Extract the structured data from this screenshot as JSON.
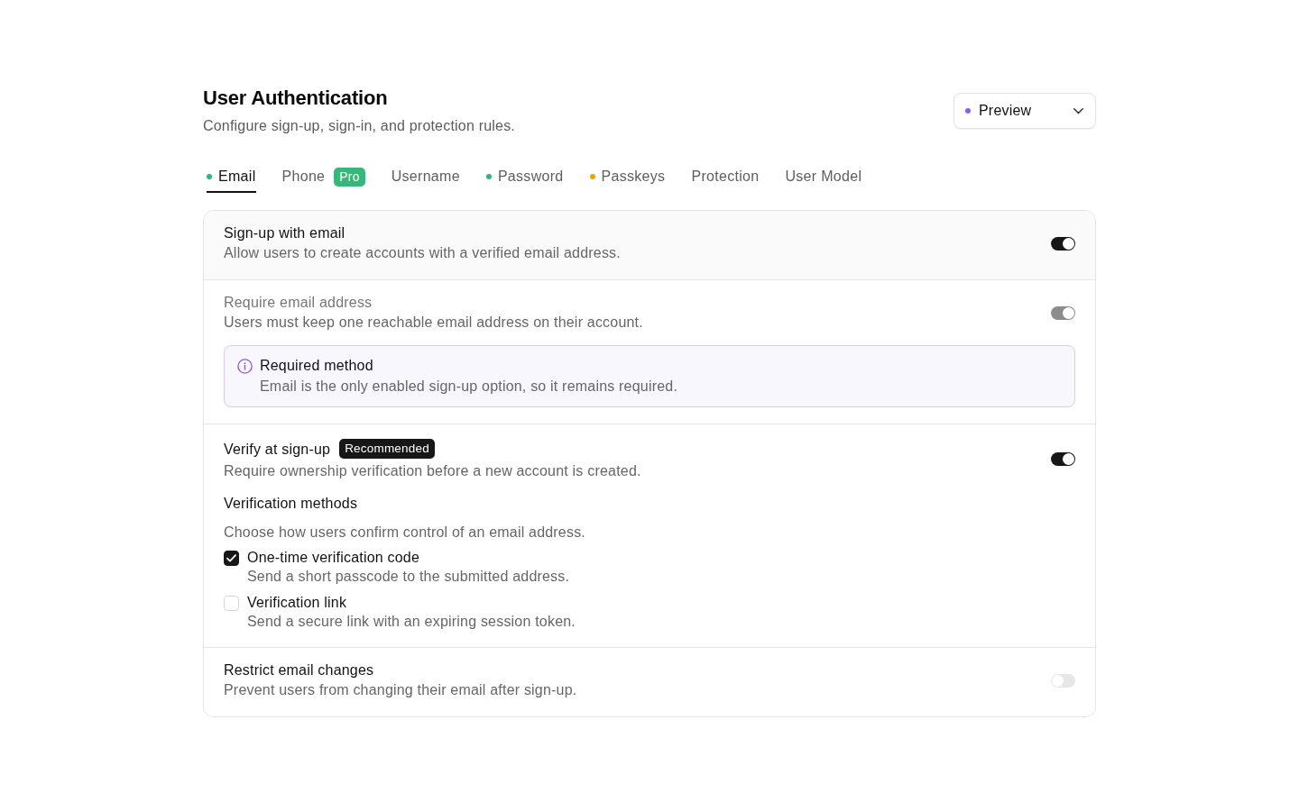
{
  "header": {
    "title": "User Authentication",
    "subtitle": "Configure sign-up, sign-in, and protection rules."
  },
  "environment_select": {
    "value": "Preview"
  },
  "tabs": [
    {
      "label": "Email",
      "selected": true,
      "color": "#2eb872"
    },
    {
      "label": "Phone",
      "selected": false,
      "badge": "Pro"
    },
    {
      "label": "Username",
      "selected": false
    },
    {
      "label": "Password",
      "selected": false,
      "color": "#2eb872"
    },
    {
      "label": "Passkeys",
      "selected": false,
      "color": "#e8a600"
    },
    {
      "label": "Protection",
      "selected": false
    },
    {
      "label": "User Model",
      "selected": false
    }
  ],
  "settings": [
    {
      "title": "Sign-up with email",
      "description": "Allow users to create accounts with a verified email address.",
      "on": true,
      "disabled": false
    },
    {
      "title": "Require email address",
      "description": "Users must keep one reachable email address on their account.",
      "on": true,
      "disabled": true,
      "notice": {
        "title": "Required method",
        "text": "Email is the only enabled sign-up option, so it remains required."
      }
    },
    {
      "title": "Verify at sign-up",
      "badge": "Recommended",
      "description": "Require ownership verification before a new account is created.",
      "on": true,
      "disabled": false,
      "methods": {
        "title": "Verification methods",
        "description": "Choose how users confirm control of an email address.",
        "options": [
          {
            "label": "One-time verification code",
            "description": "Send a short passcode to the submitted address.",
            "checked": true
          },
          {
            "label": "Verification link",
            "description": "Send a secure link with an expiring session token.",
            "checked": false
          }
        ]
      }
    },
    {
      "title": "Restrict email changes",
      "description": "Prevent users from changing their email after sign-up.",
      "on": false,
      "disabled": false
    }
  ]
}
